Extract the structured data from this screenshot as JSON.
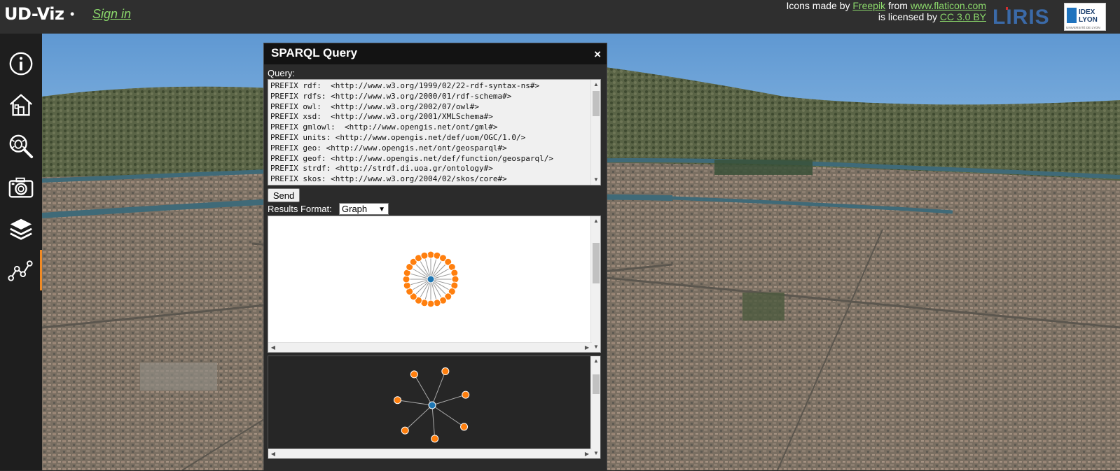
{
  "header": {
    "brand": "UD-Viz",
    "brand_dot": "•",
    "signin": "Sign in",
    "credits_line1_prefix": "Icons made by ",
    "credits_freepik": "Freepik",
    "credits_from": " from ",
    "credits_flaticon": "www.flaticon.com",
    "credits_line2_prefix": "is licensed by ",
    "credits_license": "CC 3.0 BY",
    "liris_logo_text": "LIRIS",
    "idex_logo_line1": "IDEX",
    "idex_logo_line2": "LYON",
    "idex_logo_line3": "UNIVERSITÉ DE LYON"
  },
  "sidebar": {
    "items": [
      {
        "name": "info",
        "icon": "info-icon"
      },
      {
        "name": "home",
        "icon": "home-icon"
      },
      {
        "name": "city-objects",
        "icon": "inspect-icon"
      },
      {
        "name": "camera",
        "icon": "camera-icon"
      },
      {
        "name": "layers",
        "icon": "layers-icon"
      },
      {
        "name": "sparql",
        "icon": "graph-icon",
        "active": true
      }
    ],
    "active_color": "#f08a24"
  },
  "sparql_window": {
    "title": "SPARQL Query",
    "close": "×",
    "query_label": "Query:",
    "query_text": "PREFIX rdf:  <http://www.w3.org/1999/02/22-rdf-syntax-ns#>\nPREFIX rdfs: <http://www.w3.org/2000/01/rdf-schema#>\nPREFIX owl:  <http://www.w3.org/2002/07/owl#>\nPREFIX xsd:  <http://www.w3.org/2001/XMLSchema#>\nPREFIX gmlowl:  <http://www.opengis.net/ont/gml#>\nPREFIX units: <http://www.opengis.net/def/uom/OGC/1.0/>\nPREFIX geo: <http://www.opengis.net/ont/geosparql#>\nPREFIX geof: <http://www.opengis.net/def/function/geosparql/>\nPREFIX strdf: <http://strdf.di.uoa.gr/ontology#>\nPREFIX skos: <http://www.w3.org/2004/02/skos/core#>",
    "send_label": "Send",
    "results_format_label": "Results Format:",
    "results_format_value": "Graph",
    "graph1": {
      "center_color": "#1f77b4",
      "leaf_color": "#ff7f0e",
      "leaf_count": 24
    },
    "graph2": {
      "center_color": "#1f77b4",
      "leaf_color": "#ff7f0e",
      "leaf_count": 7
    }
  },
  "colors": {
    "header_bg": "#2f2f2f",
    "link_green": "#8bd86b"
  }
}
